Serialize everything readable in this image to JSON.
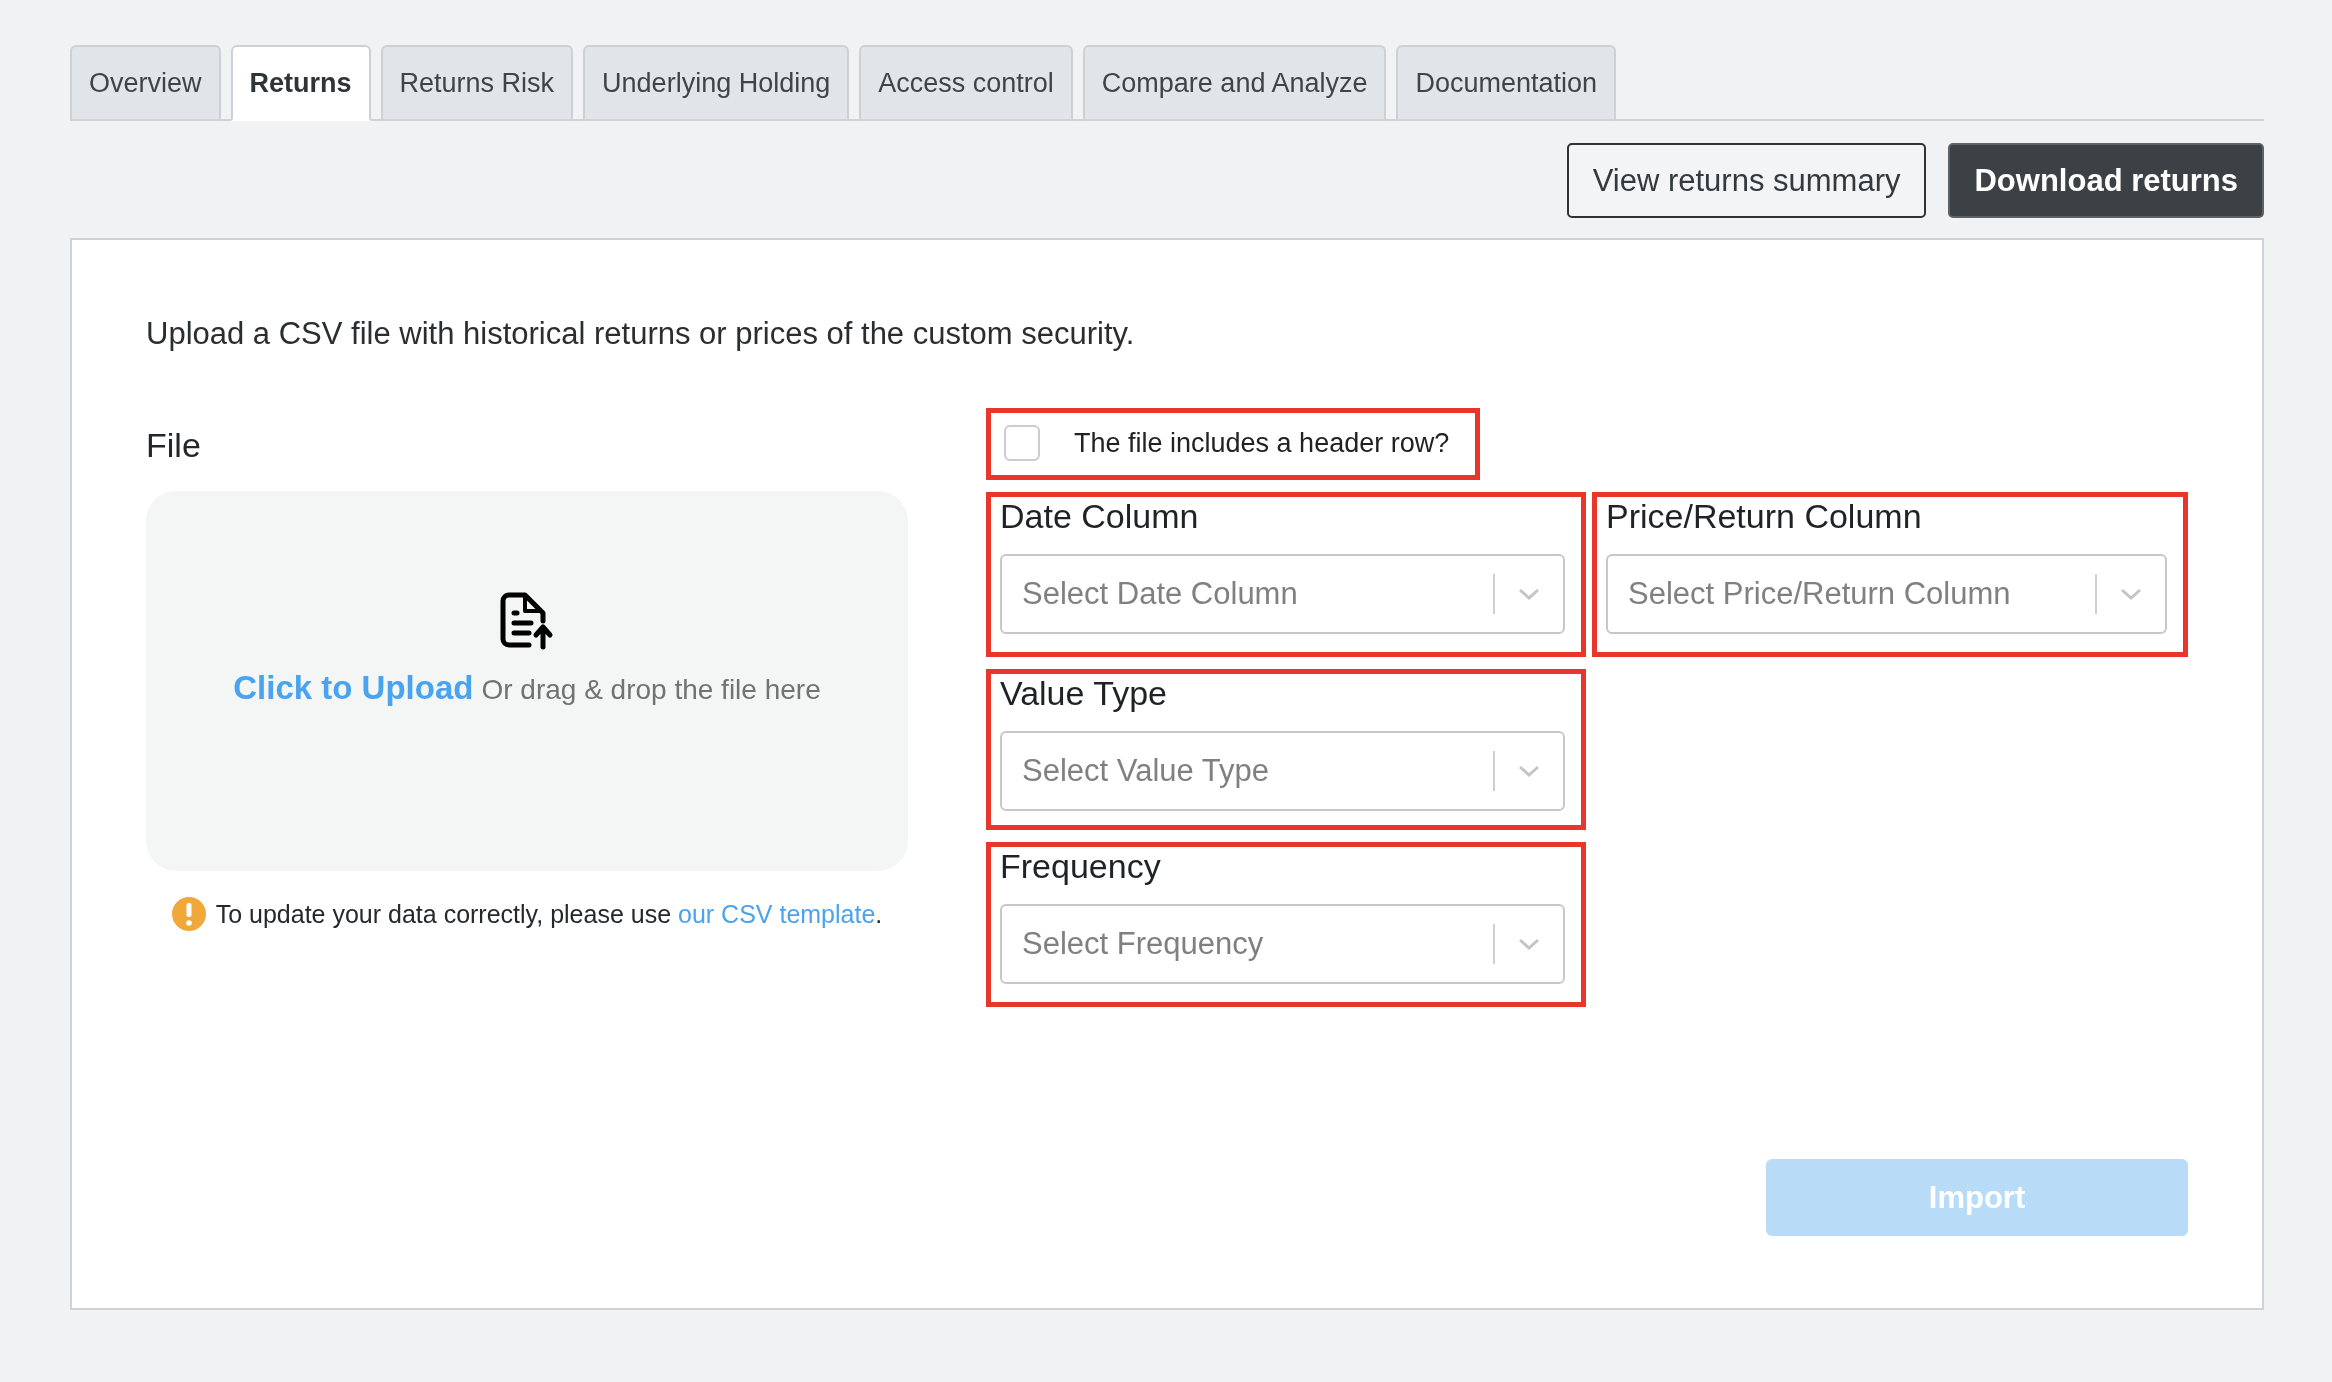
{
  "tabs": [
    {
      "label": "Overview",
      "selected": false
    },
    {
      "label": "Returns",
      "selected": true
    },
    {
      "label": "Returns Risk",
      "selected": false
    },
    {
      "label": "Underlying Holding",
      "selected": false
    },
    {
      "label": "Access control",
      "selected": false
    },
    {
      "label": "Compare and Analyze",
      "selected": false
    },
    {
      "label": "Documentation",
      "selected": false
    }
  ],
  "actions": [
    {
      "label": "View returns summary",
      "kind": "outline"
    },
    {
      "label": "Download returns",
      "kind": "solid"
    }
  ],
  "intro": "Upload a CSV file with historical returns or prices of the custom security.",
  "file": {
    "label": "File",
    "upload_link": "Click to Upload",
    "upload_hint": "Or drag & drop the file here",
    "notice_text": "To update your data correctly, please use",
    "notice_link": "our CSV template",
    "notice_end": "."
  },
  "header_row": {
    "label": "The file includes a header row?",
    "checked": false,
    "highlighted": true
  },
  "selects": [
    {
      "label": "Date Column",
      "placeholder": "Select Date Column",
      "highlighted": true
    },
    {
      "label": "Price/Return Column",
      "placeholder": "Select Price/Return Column",
      "highlighted": true
    },
    {
      "label": "Value Type",
      "placeholder": "Select Value Type",
      "highlighted": true
    },
    {
      "label": "Frequency",
      "placeholder": "Select Frequency",
      "highlighted": true
    }
  ],
  "import_button": {
    "label": "Import",
    "disabled": true
  }
}
